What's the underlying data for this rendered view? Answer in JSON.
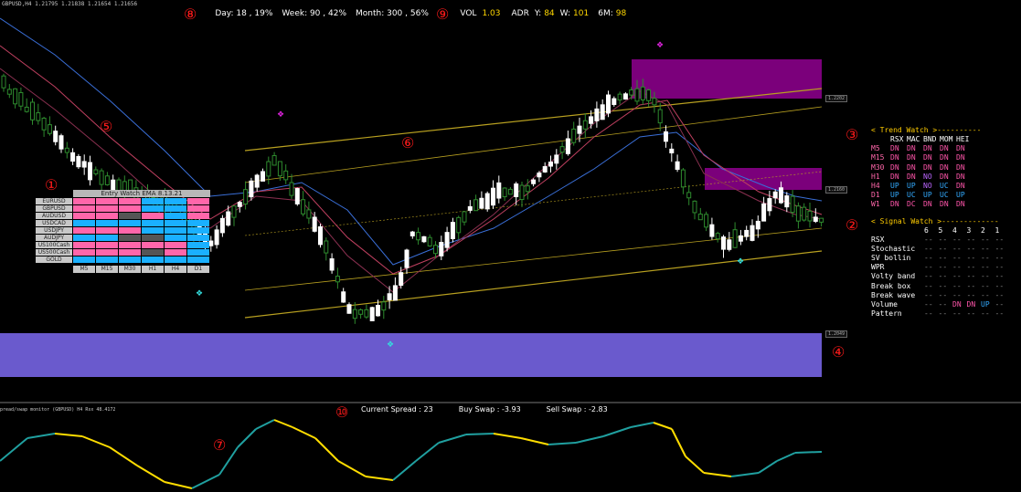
{
  "header": {
    "symbol_label": "GBPUSD,H4  1.21795 1.21838 1.21654 1.21656",
    "day_text": "Day: 18 , 19%",
    "week_text": "Week: 90 , 42%",
    "month_text": "Month: 300 , 56%",
    "vol_label": "VOL",
    "vol_value": "1.03",
    "adr_label": "ADR",
    "y_label": "Y:",
    "y_value": "84",
    "w_label": "W:",
    "w_value": "101",
    "sixm_label": "6M:",
    "sixm_value": "98"
  },
  "markers": {
    "m1": "①",
    "m2": "②",
    "m3": "③",
    "m4": "④",
    "m5": "⑤",
    "m6": "⑥",
    "m7": "⑦",
    "m8": "⑧",
    "m9": "⑨",
    "m10": "⑩"
  },
  "entry_watch": {
    "title": "Entry Watch EMA 8.13.21",
    "symbols": [
      "EURUSD",
      "GBPUSD",
      "AUDUSD",
      "USDCAD",
      "USDJPY",
      "AUDJPY",
      "US100Cash",
      "US500Cash",
      "GOLD"
    ],
    "timeframes": [
      "M5",
      "M15",
      "M30",
      "H1",
      "H4",
      "D1"
    ],
    "grid": [
      [
        "pink",
        "pink",
        "pink",
        "blue",
        "blue",
        "pink"
      ],
      [
        "pink",
        "pink",
        "pink",
        "blue",
        "blue",
        "pink"
      ],
      [
        "pink",
        "pink",
        "gray",
        "pink",
        "blue",
        "pink"
      ],
      [
        "blue",
        "blue",
        "blue",
        "blue",
        "blue",
        "blue"
      ],
      [
        "pink",
        "pink",
        "pink",
        "blue",
        "blue",
        "blue"
      ],
      [
        "blue",
        "blue",
        "gray",
        "gray",
        "blue",
        "blue"
      ],
      [
        "pink",
        "pink",
        "pink",
        "pink",
        "pink",
        "blue"
      ],
      [
        "pink",
        "pink",
        "pink",
        "gray",
        "pink",
        "blue"
      ],
      [
        "blue",
        "blue",
        "blue",
        "blue",
        "blue",
        "blue"
      ]
    ]
  },
  "trend_watch": {
    "title": "< Trend Watch >----------",
    "columns": [
      "RSX",
      "MAC",
      "BND",
      "MOM",
      "HEI"
    ],
    "rows": [
      {
        "tf": "M5",
        "vals": [
          "DN",
          "DN",
          "DN",
          "DN",
          "DN"
        ]
      },
      {
        "tf": "M15",
        "vals": [
          "DN",
          "DN",
          "DN",
          "DN",
          "DN"
        ]
      },
      {
        "tf": "M30",
        "vals": [
          "DN",
          "DN",
          "DN",
          "DN",
          "DN"
        ]
      },
      {
        "tf": "H1",
        "vals": [
          "DN",
          "DN",
          "NO",
          "DN",
          "DN"
        ]
      },
      {
        "tf": "H4",
        "vals": [
          "UP",
          "UP",
          "NO",
          "UC",
          "DN"
        ]
      },
      {
        "tf": "D1",
        "vals": [
          "UP",
          "UC",
          "UP",
          "UC",
          "UP"
        ]
      },
      {
        "tf": "W1",
        "vals": [
          "DN",
          "DC",
          "DN",
          "DN",
          "DN"
        ]
      }
    ]
  },
  "signal_watch": {
    "title": "< Signal Watch >-------------",
    "columns": [
      "6",
      "5",
      "4",
      "3",
      "2",
      "1"
    ],
    "rows": [
      {
        "name": "RSX",
        "vals": [
          "--",
          "--",
          "--",
          "--",
          "--",
          "--"
        ]
      },
      {
        "name": "Stochastic",
        "vals": [
          "--",
          "--",
          "--",
          "--",
          "--",
          "--"
        ]
      },
      {
        "name": "SV bollin",
        "vals": [
          "--",
          "--",
          "--",
          "--",
          "--",
          "--"
        ]
      },
      {
        "name": "WPR",
        "vals": [
          "--",
          "--",
          "--",
          "--",
          "--",
          "--"
        ]
      },
      {
        "name": "Volty band",
        "vals": [
          "--",
          "--",
          "--",
          "--",
          "--",
          "--"
        ]
      },
      {
        "name": "Break box",
        "vals": [
          "--",
          "--",
          "--",
          "--",
          "--",
          "--"
        ]
      },
      {
        "name": "Break wave",
        "vals": [
          "--",
          "--",
          "--",
          "--",
          "--",
          "--"
        ]
      },
      {
        "name": "Volume",
        "vals": [
          "--",
          "--",
          "DN",
          "DN",
          "UP",
          "--"
        ]
      },
      {
        "name": "Pattern",
        "vals": [
          "--",
          "--",
          "--",
          "--",
          "--",
          "--"
        ]
      }
    ]
  },
  "price_tags": {
    "tag1": "1.2202",
    "tag2": "1.2160",
    "tag3": "1.2049"
  },
  "indicator": {
    "label": "pread/swap monitor (GBPUSD)  H4  Rsx  48.4172",
    "spread_text": "Current Spread : 23",
    "buy_swap_text": "Buy Swap : -3.93",
    "sell_swap_text": "Sell Swap : -2.83"
  },
  "colors": {
    "bull_candle": "#ffffff",
    "bear_candle": "#2e8b2e",
    "zone_purple": "#7b007b",
    "zone_blue": "#6a5acd",
    "channel": "#b8a020",
    "ema_blue": "#3a6fd8",
    "ema_red": "#c04060",
    "signal_cyan": "#33dddd",
    "signal_magenta": "#dd22dd",
    "osc_yellow": "#ffdd00",
    "osc_teal": "#20a0a0",
    "tag_pink": "#ff66aa",
    "tag_blue": "#1ab0ff",
    "tag_gray": "#555555"
  }
}
